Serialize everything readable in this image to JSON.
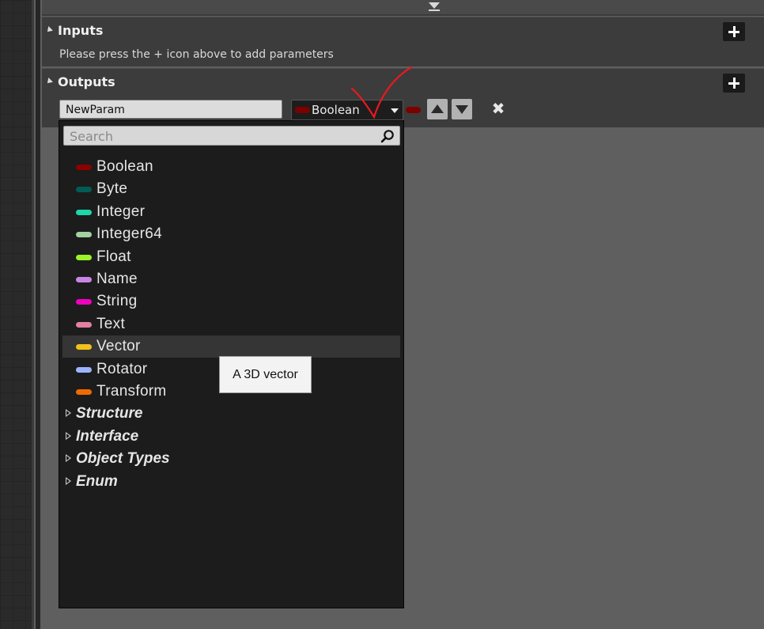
{
  "inputs": {
    "title": "Inputs",
    "hint": "Please press the + icon above to add parameters"
  },
  "outputs": {
    "title": "Outputs",
    "param": {
      "name": "NewParam",
      "type_label": "Boolean",
      "type_color": "#7c0000"
    }
  },
  "type_menu": {
    "search_placeholder": "Search",
    "types": [
      {
        "label": "Boolean",
        "color": "#8b0000"
      },
      {
        "label": "Byte",
        "color": "#005c55"
      },
      {
        "label": "Integer",
        "color": "#1ed6a6"
      },
      {
        "label": "Integer64",
        "color": "#a2d3a0"
      },
      {
        "label": "Float",
        "color": "#9cf22b"
      },
      {
        "label": "Name",
        "color": "#c786e6"
      },
      {
        "label": "String",
        "color": "#f000c0"
      },
      {
        "label": "Text",
        "color": "#e47fa2"
      },
      {
        "label": "Vector",
        "color": "#f2c01a"
      },
      {
        "label": "Rotator",
        "color": "#9db4ff"
      },
      {
        "label": "Transform",
        "color": "#ef6a00"
      }
    ],
    "highlighted": "Vector",
    "categories": [
      "Structure",
      "Interface",
      "Object Types",
      "Enum"
    ]
  },
  "tooltip": "A 3D vector",
  "annotation_color": "#e8191f"
}
